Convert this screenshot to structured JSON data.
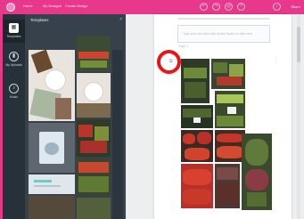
{
  "topbar": {
    "nav": [
      "Home",
      "My Designs",
      "Create Design"
    ],
    "share": "Share"
  },
  "rail": {
    "items": [
      {
        "label": "Templates",
        "icon": "grid-icon",
        "active": true
      },
      {
        "label": "My Uploads",
        "icon": "upload-icon",
        "active": false
      },
      {
        "label": "Music",
        "icon": "music-icon",
        "active": false
      }
    ]
  },
  "panel": {
    "title": "Templates",
    "close": "×"
  },
  "document": {
    "text_hint": "Type your text here with Adobe Spark or other text",
    "page_label": "Page 1"
  },
  "colors": {
    "brand": "#e8388c",
    "highlight": "#e5171b",
    "rail": "#27313a",
    "panel": "#36414b"
  }
}
